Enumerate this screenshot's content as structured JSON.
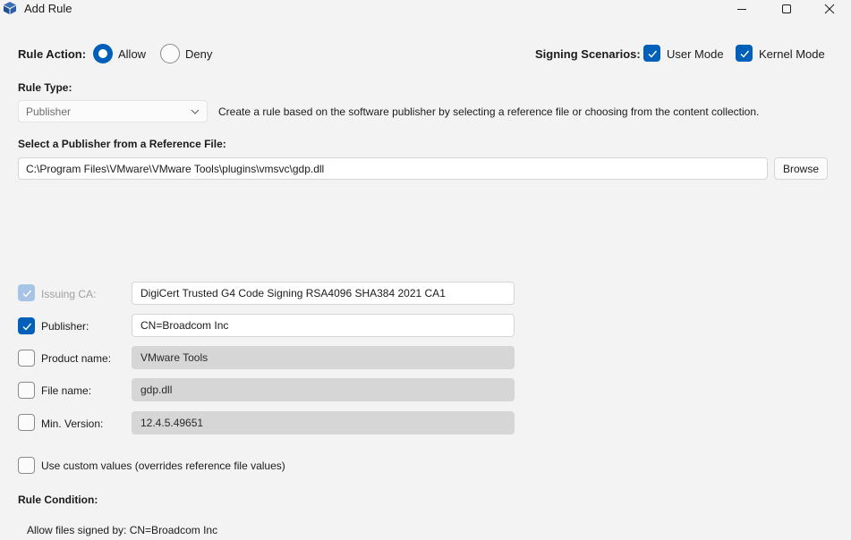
{
  "window": {
    "title": "Add Rule",
    "icon": "cube-icon",
    "controls": {
      "minimize": "minimize-icon",
      "maximize": "maximize-icon",
      "close": "close-icon"
    }
  },
  "rule_action": {
    "label": "Rule Action:",
    "options": [
      {
        "label": "Allow",
        "selected": true
      },
      {
        "label": "Deny",
        "selected": false
      }
    ]
  },
  "signing": {
    "label": "Signing Scenarios:",
    "options": [
      {
        "label": "User Mode",
        "checked": true
      },
      {
        "label": "Kernel Mode",
        "checked": true
      }
    ]
  },
  "rule_type": {
    "label": "Rule Type:",
    "selected": "Publisher",
    "description": "Create a rule based on the software publisher by selecting a reference file or choosing from the content collection."
  },
  "reference": {
    "label": "Select a Publisher from a Reference File:",
    "path": "C:\\Program Files\\VMware\\VMware Tools\\plugins\\vmsvc\\gdp.dll",
    "browse_label": "Browse"
  },
  "fields": [
    {
      "label": "Issuing CA:",
      "value": "DigiCert Trusted G4 Code Signing RSA4096 SHA384 2021 CA1",
      "checked": true,
      "disabled": true
    },
    {
      "label": "Publisher:",
      "value": "CN=Broadcom Inc",
      "checked": true,
      "disabled": false
    },
    {
      "label": "Product name:",
      "value": "VMware Tools",
      "checked": false,
      "disabled": false
    },
    {
      "label": "File name:",
      "value": "gdp.dll",
      "checked": false,
      "disabled": false
    },
    {
      "label": "Min. Version:",
      "value": "12.4.5.49651",
      "checked": false,
      "disabled": false
    }
  ],
  "custom_values": {
    "label": "Use custom values (overrides reference file values)",
    "checked": false
  },
  "condition": {
    "label": "Rule Condition:",
    "text": "Allow files signed by: CN=Broadcom Inc"
  },
  "colors": {
    "accent": "#005fb8",
    "background": "#f3f3f3",
    "disabled_accent": "#a7c4e4"
  }
}
